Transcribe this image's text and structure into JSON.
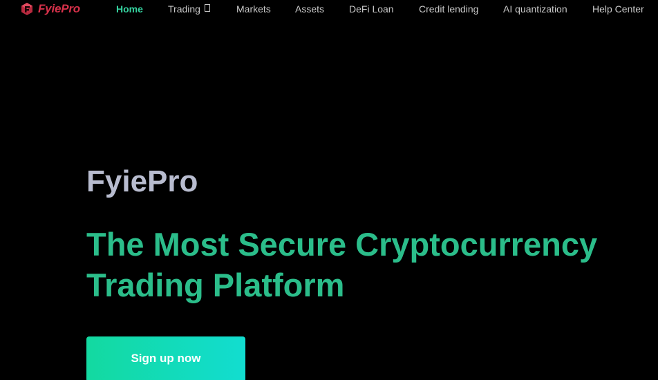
{
  "brand": {
    "name": "FyiePro",
    "colors": {
      "logo": "#d6314a",
      "accent": "#35d3a0",
      "headline": "#2bbd8a"
    }
  },
  "nav": {
    "items": [
      {
        "label": "Home",
        "active": true
      },
      {
        "label": "Trading",
        "icon": "dropdown-box-glyph"
      },
      {
        "label": "Markets"
      },
      {
        "label": "Assets"
      },
      {
        "label": "DeFi Loan"
      },
      {
        "label": "Credit lending"
      },
      {
        "label": "AI quantization"
      },
      {
        "label": "Help Center"
      }
    ]
  },
  "hero": {
    "brand_title": "FyiePro",
    "headline": "The Most Secure Cryptocurrency Trading Platform",
    "cta_label": "Sign up now"
  }
}
